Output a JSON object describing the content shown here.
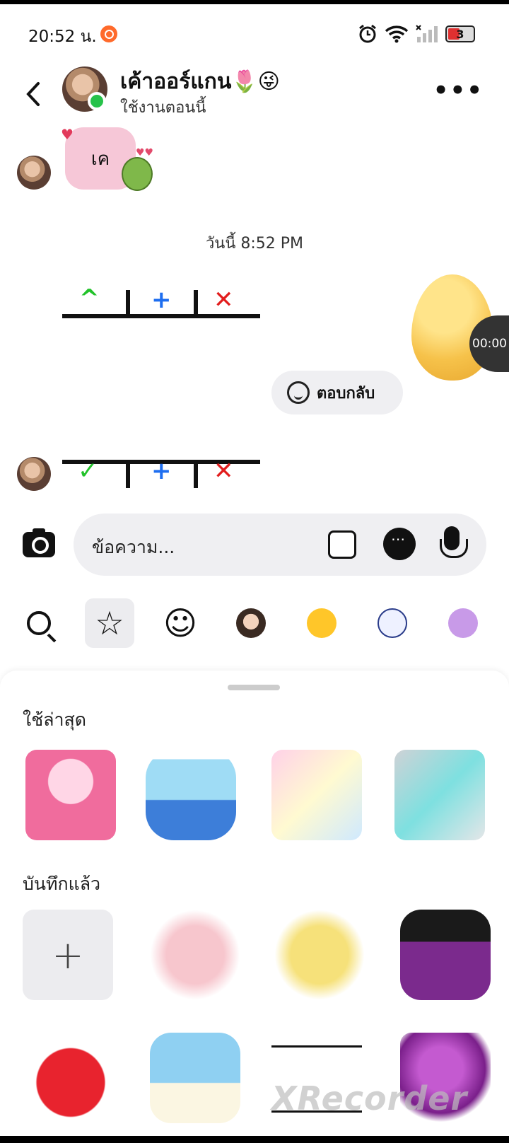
{
  "status_bar": {
    "time": "20:52 น.",
    "battery": "3"
  },
  "header": {
    "name": "เค้าออร์แกน🌷😜",
    "status": "ใช้งานตอนนี้"
  },
  "messages": {
    "first_text": "เค",
    "date_separator": "วันนี้ 8:52 PM",
    "timer": "00:00",
    "reply_label": "ตอบกลับ"
  },
  "sticker_marks": {
    "top": [
      "^",
      "+",
      "✕"
    ],
    "bottom": [
      "✓",
      "+",
      "✕"
    ]
  },
  "composer": {
    "placeholder": "ข้อความ..."
  },
  "tray": {
    "tabs": [
      "search-icon",
      "star-icon",
      "emoji-icon",
      "avatar-sticker",
      "heart-eyes-emoji",
      "stamp-sticker",
      "purple-cat-sticker"
    ],
    "recent_label": "ใช้ล่าสุด",
    "saved_label": "บันทึกแล้ว",
    "add_label": "+"
  },
  "watermark": "XRecorder"
}
